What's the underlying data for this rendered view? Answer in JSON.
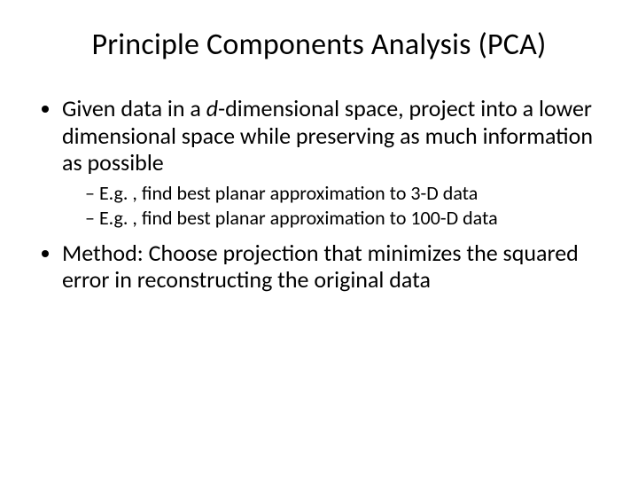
{
  "title": "Principle Components Analysis (PCA)",
  "bullets": [
    {
      "pre": "Given data in a ",
      "italic": "d",
      "post": "-dimensional space, project into a lower dimensional space while preserving as much information as possible",
      "sub": [
        "E.g. , find best planar approximation to 3-D data",
        "E.g. , find best planar approximation to 100-D data"
      ]
    },
    {
      "pre": "Method: Choose projection that minimizes the squared error in reconstructing the original data",
      "italic": "",
      "post": "",
      "sub": []
    }
  ]
}
